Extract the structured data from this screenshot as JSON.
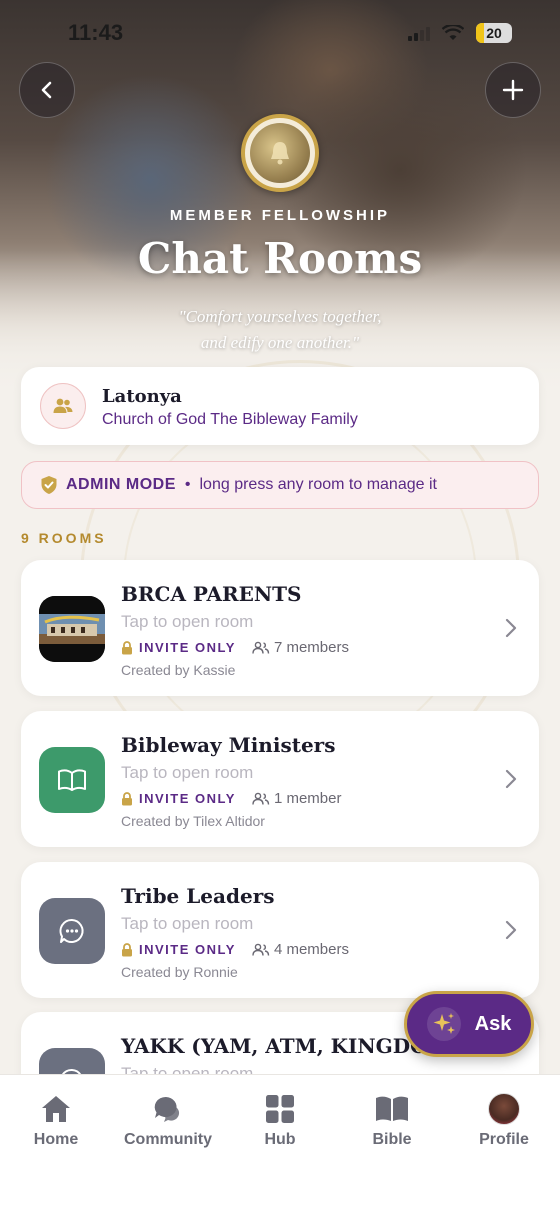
{
  "status_bar": {
    "time": "11:43",
    "battery": "20"
  },
  "header": {
    "eyebrow": "MEMBER FELLOWSHIP",
    "title": "Chat Rooms",
    "quote_line1": "\"Comfort yourselves together,",
    "quote_line2": "and edify one another.\""
  },
  "user": {
    "name": "Latonya",
    "church": "Church of God The Bibleway Family"
  },
  "admin": {
    "label": "ADMIN MODE",
    "separator": "•",
    "hint": "long press any room to manage it"
  },
  "rooms_count": "9 ROOMS",
  "rooms": [
    {
      "name": "BRCA PARENTS",
      "subtitle": "Tap to open room",
      "badge": "INVITE ONLY",
      "members": "7 members",
      "creator": "Created by Kassie",
      "icon": "photo",
      "icon_color": "#1a1a1a"
    },
    {
      "name": "Bibleway Ministers",
      "subtitle": "Tap to open room",
      "badge": "INVITE ONLY",
      "members": "1 member",
      "creator": "Created by Tilex Altidor",
      "icon": "book-icon",
      "icon_color": "#3d9a6b"
    },
    {
      "name": "Tribe Leaders",
      "subtitle": "Tap to open room",
      "badge": "INVITE ONLY",
      "members": "4 members",
      "creator": "Created by Ronnie",
      "icon": "chat-icon",
      "icon_color": "#6b7080"
    },
    {
      "name": "YAKK (YAM, ATM, KINGDOM K",
      "subtitle": "Tap to open room",
      "icon": "chat-icon",
      "icon_color": "#6b7080"
    }
  ],
  "ask_button": {
    "label": "Ask"
  },
  "tabs": [
    {
      "label": "Home",
      "icon": "home-icon"
    },
    {
      "label": "Community",
      "icon": "community-icon"
    },
    {
      "label": "Hub",
      "icon": "grid-icon"
    },
    {
      "label": "Bible",
      "icon": "bible-icon"
    },
    {
      "label": "Profile",
      "icon": "avatar"
    }
  ],
  "colors": {
    "accent_purple": "#5b2a86",
    "gold": "#c9a448",
    "background": "#f4f1ec"
  }
}
